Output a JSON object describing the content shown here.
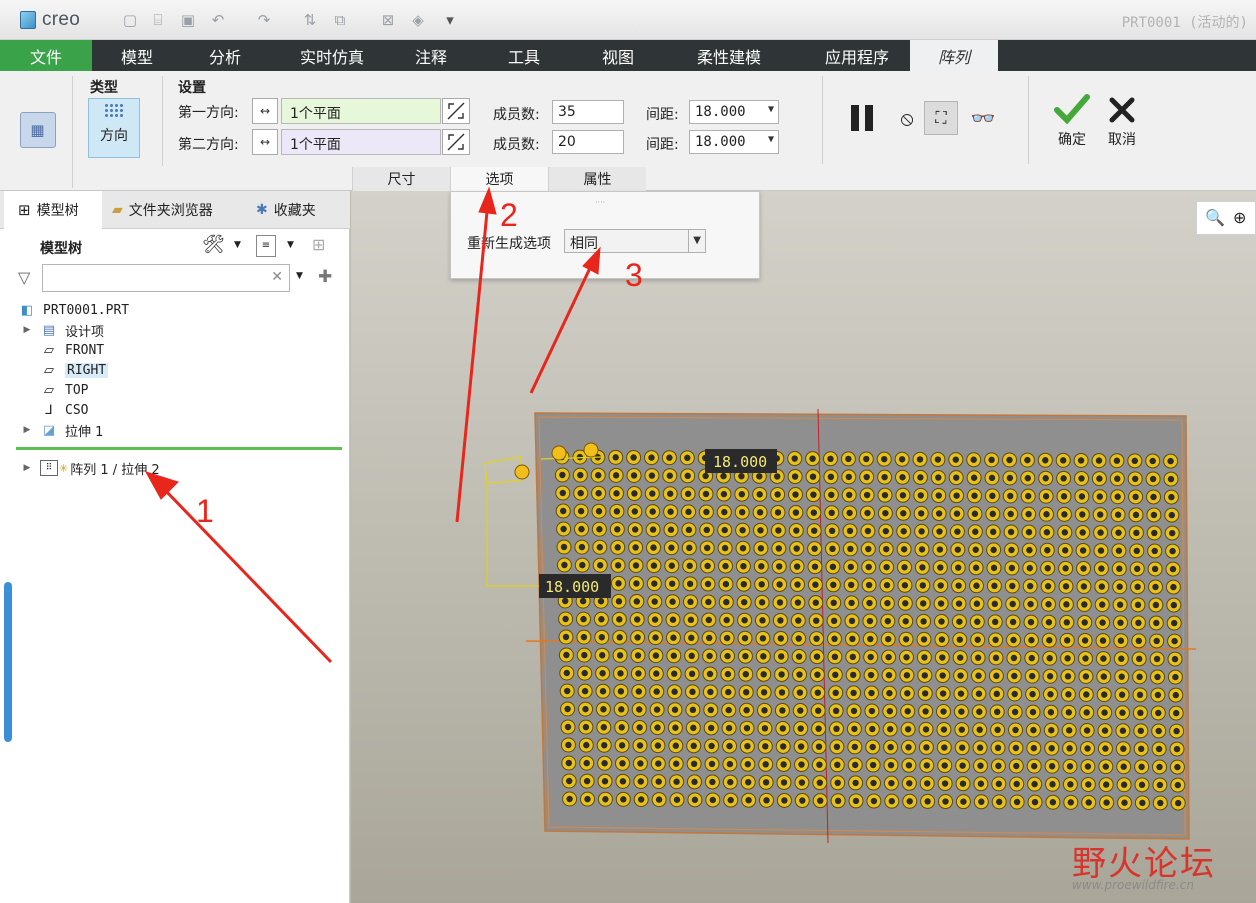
{
  "app": {
    "logo": "creo",
    "window_title": "PRT0001 (活动的)"
  },
  "menu": [
    "文件",
    "模型",
    "分析",
    "实时仿真",
    "注释",
    "工具",
    "视图",
    "柔性建模",
    "应用程序",
    "阵列"
  ],
  "ribbon": {
    "type_label": "类型",
    "type_value": "方向",
    "settings_label": "设置",
    "dir1_label": "第一方向:",
    "dir2_label": "第二方向:",
    "dir1_ref": "1个平面",
    "dir2_ref": "1个平面",
    "members_label": "成员数:",
    "members1": "35",
    "members2": "20",
    "spacing_label": "间距:",
    "spacing1": "18.000",
    "spacing2": "18.000",
    "ok_label": "确定",
    "cancel_label": "取消",
    "tabs": [
      "尺寸",
      "选项",
      "属性"
    ]
  },
  "options_panel": {
    "regen_label": "重新生成选项",
    "regen_value": "相同"
  },
  "left_panel": {
    "tabs": [
      "模型树",
      "文件夹浏览器",
      "收藏夹"
    ],
    "tree_title": "模型树",
    "search_placeholder": "",
    "items": [
      {
        "label": "PRT0001.PRT",
        "icon": "part-icon"
      },
      {
        "label": "设计项",
        "icon": "design-items-icon"
      },
      {
        "label": "FRONT",
        "icon": "datum-plane-icon"
      },
      {
        "label": "RIGHT",
        "icon": "datum-plane-icon"
      },
      {
        "label": "TOP",
        "icon": "datum-plane-icon"
      },
      {
        "label": "CSO",
        "icon": "csys-icon"
      },
      {
        "label": "拉伸 1",
        "icon": "extrude-icon"
      },
      {
        "label": "阵列 1 / 拉伸 2",
        "icon": "pattern-icon"
      }
    ]
  },
  "viewport": {
    "dim_h": "18.000",
    "dim_v": "18.000",
    "pattern_cols": 35,
    "pattern_rows": 20
  },
  "annotations": {
    "a1": "1",
    "a2": "2",
    "a3": "3",
    "color": "#e8261c"
  },
  "watermark": {
    "text": "野火论坛",
    "url": "www.proewildfire.cn"
  },
  "colors": {
    "file_menu": "#3aa34a",
    "menubar": "#2f3437",
    "marker": "#e8c21a"
  }
}
